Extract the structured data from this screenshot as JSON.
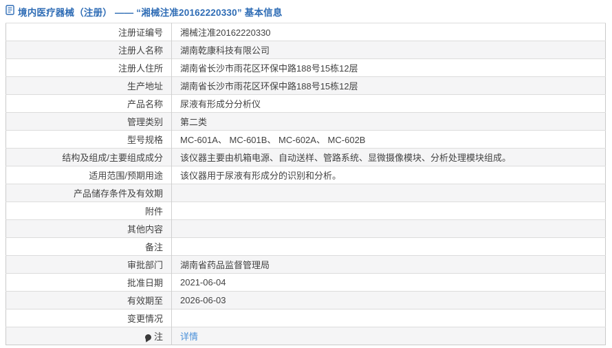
{
  "page": {
    "title": "境内医疗器械（注册） —— “湘械注准20162220330” 基本信息",
    "title_icon": "document-icon"
  },
  "colors": {
    "title_blue": "#2e6cb5",
    "link_blue": "#4a90d9",
    "text": "#424242",
    "row_alt_bg": "#f5f5f6",
    "table_border": "#c9c9c9"
  },
  "table": {
    "rows": [
      {
        "label": "注册证编号",
        "value": "湘械注准20162220330"
      },
      {
        "label": "注册人名称",
        "value": "湖南乾康科技有限公司"
      },
      {
        "label": "注册人住所",
        "value": "湖南省长沙市雨花区环保中路188号15栋12层"
      },
      {
        "label": "生产地址",
        "value": "湖南省长沙市雨花区环保中路188号15栋12层"
      },
      {
        "label": "产品名称",
        "value": "尿液有形成分分析仪"
      },
      {
        "label": "管理类别",
        "value": "第二类"
      },
      {
        "label": "型号规格",
        "value": "MC-601A、 MC-601B、 MC-602A、 MC-602B"
      },
      {
        "label": "结构及组成/主要组成成分",
        "value": "该仪器主要由机箱电源、自动送样、管路系统、显微摄像模块、分析处理模块组成。"
      },
      {
        "label": "适用范围/预期用途",
        "value": "该仪器用于尿液有形成分的识别和分析。"
      },
      {
        "label": "产品储存条件及有效期",
        "value": ""
      },
      {
        "label": "附件",
        "value": ""
      },
      {
        "label": "其他内容",
        "value": ""
      },
      {
        "label": "备注",
        "value": ""
      },
      {
        "label": "审批部门",
        "value": "湖南省药品监督管理局"
      },
      {
        "label": "批准日期",
        "value": "2021-06-04"
      },
      {
        "label": "有效期至",
        "value": "2026-06-03"
      },
      {
        "label": "变更情况",
        "value": ""
      },
      {
        "label": "注",
        "value": "详情",
        "label_icon": "note-balloon-icon",
        "value_link": true
      }
    ]
  }
}
